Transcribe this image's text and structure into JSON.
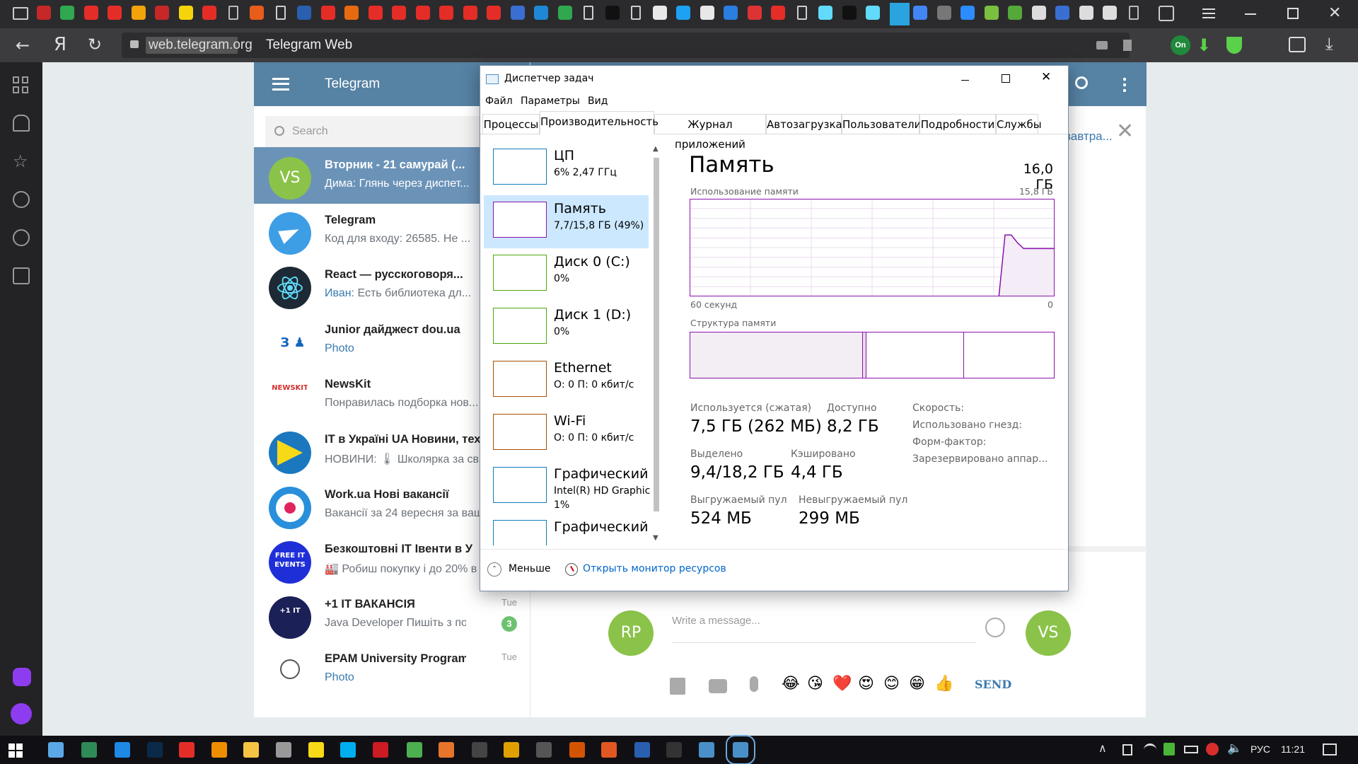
{
  "browser": {
    "url": "web.telegram.org",
    "page_title": "Telegram Web",
    "tab_icons": [
      "window-icon",
      "x-icon",
      "plus-icon",
      "youtube-icon",
      "youtube-icon",
      "bc-icon",
      "x-icon",
      "borussia-icon",
      "youtube-icon",
      "back-arrow-icon",
      "fc-icon",
      "doc-icon",
      "globe-icon",
      "youtube-icon",
      "paw-icon",
      "youtube-icon",
      "youtube-icon",
      "youtube-icon",
      "youtube-icon",
      "youtube-icon",
      "mail-icon",
      "image-icon",
      "w-icon",
      "chat-icon",
      "doc-icon",
      "m-icon",
      "doc-icon",
      "t-icon",
      "circle-icon",
      "t-icon",
      "play-icon",
      "shield-icon",
      "yandex-icon",
      "doc-icon",
      "react-icon",
      "m-icon",
      "react-icon",
      "telegram-icon",
      "docs-icon",
      "tab-icon",
      "zoom-icon",
      "sp-icon",
      "hex-icon",
      "github-icon",
      "image-icon",
      "github-icon",
      "github-icon",
      "new-tab-icon"
    ]
  },
  "telegram": {
    "header_title": "Telegram",
    "search_placeholder": "Search",
    "chats": [
      {
        "avatar_text": "VS",
        "title": "Вторник - 21 самурай (...",
        "message": "Дима: Глянь через диспет...",
        "selected": true,
        "avatar_color": "#8bc34a"
      },
      {
        "avatar_text": "",
        "title": "Telegram",
        "message": "Код для входу: 26585. Не ...",
        "avatar_color": "#3d9ee5"
      },
      {
        "avatar_text": "",
        "title": "React — русскоговоря...",
        "sender": "Иван:",
        "message": "Есть библиотека дл...",
        "avatar_color": "#1d2a35"
      },
      {
        "avatar_text": "",
        "title": "Junior дайджест dou.ua",
        "message": "Photo",
        "avatar_color": "#ffffff"
      },
      {
        "avatar_text": "NEWSKIT",
        "title": "NewsKit",
        "message": "Понравилась подборка нов...",
        "avatar_color": "#ffffff"
      },
      {
        "avatar_text": "",
        "title": "IT в Україні UA Новини, тех",
        "message": "НОВИНИ:  🌡 Школярка за сві",
        "avatar_color": "#1b78bf"
      },
      {
        "avatar_text": "",
        "title": "Work.ua Нові вакансії",
        "message": "Вакансії за 24 вересня за ваш",
        "avatar_color": "#2a8fdb"
      },
      {
        "avatar_text": "FREE IT EVENTS",
        "title": "Безкоштовні IT Івенти в У",
        "message": "🏭 Робиш покупку і до 20% в",
        "avatar_color": "#1f2fd8"
      },
      {
        "avatar_text": "+1 IT",
        "title": "+1 IT ВАКАНСІЯ",
        "message": "Java Developer Пишіть з помітк...",
        "time": "Tue",
        "badge": "3",
        "avatar_color": "#1b2057"
      },
      {
        "avatar_text": "",
        "title": "EPAM University Programs UA",
        "message": "Photo",
        "time": "Tue",
        "avatar_color": "#ffffff"
      }
    ],
    "right_header_partial": "завтра...",
    "composer": {
      "placeholder": "Write a message...",
      "send_label": "SEND",
      "my_avatar": "RP",
      "peer_avatar": "VS",
      "emojis": [
        "😂",
        "😘",
        "❤️",
        "😍",
        "😊",
        "😁",
        "👍"
      ]
    }
  },
  "task_manager": {
    "title": "Диспетчер задач",
    "menu": [
      "Файл",
      "Параметры",
      "Вид"
    ],
    "tabs": [
      "Процессы",
      "Производительность",
      "Журнал приложений",
      "Автозагрузка",
      "Пользователи",
      "Подробности",
      "Службы"
    ],
    "active_tab": "Производительность",
    "resources": [
      {
        "name": "ЦП",
        "sub": "6% 2,47 ГГц",
        "color": "#117dbb"
      },
      {
        "name": "Память",
        "sub": "7,7/15,8 ГБ (49%)",
        "color": "#8b12ae",
        "selected": true
      },
      {
        "name": "Диск 0 (C:)",
        "sub": "0%",
        "color": "#4da60c"
      },
      {
        "name": "Диск 1 (D:)",
        "sub": "0%",
        "color": "#4da60c"
      },
      {
        "name": "Ethernet",
        "sub": "О: 0 П: 0 кбит/с",
        "color": "#a74f01"
      },
      {
        "name": "Wi-Fi",
        "sub": "О: 0 П: 0 кбит/с",
        "color": "#a74f01"
      },
      {
        "name": "Графический п",
        "sub": "Intel(R) HD Graphics",
        "sub2": "1%",
        "color": "#117dbb"
      },
      {
        "name": "Графический п",
        "sub": "",
        "color": "#117dbb"
      }
    ],
    "memory": {
      "heading": "Память",
      "total": "16,0 ГБ",
      "usage_label": "Использование памяти",
      "usage_max": "15,8 ГБ",
      "time_left": "60 секунд",
      "time_right": "0",
      "structure_label": "Структура памяти",
      "in_use_label": "Используется (сжатая)",
      "in_use": "7,5 ГБ (262 МБ)",
      "available_label": "Доступно",
      "available": "8,2 ГБ",
      "committed_label": "Выделено",
      "committed": "9,4/18,2 ГБ",
      "cached_label": "Кэшировано",
      "cached": "4,4 ГБ",
      "paged_label": "Выгружаемый пул",
      "paged": "524 МБ",
      "nonpaged_label": "Невыгружаемый пул",
      "nonpaged": "299 МБ",
      "speed_label": "Скорость:",
      "slots_label": "Использовано гнезд:",
      "form_label": "Форм-фактор:",
      "reserved_label": "Зарезервировано аппар...",
      "usage_series": [
        0,
        0,
        0,
        0,
        0,
        0,
        0,
        0,
        0,
        0,
        0,
        0,
        0,
        0,
        0,
        0,
        0,
        0,
        0,
        0,
        0,
        0,
        0,
        0,
        0,
        0,
        0,
        0,
        0,
        0,
        0,
        0,
        0,
        0,
        0,
        0,
        0,
        0,
        0,
        0,
        0,
        0,
        0,
        0,
        0,
        0,
        0,
        0,
        0,
        0,
        0,
        0.63,
        0.63,
        0.55,
        0.49,
        0.49,
        0.49,
        0.49,
        0.49,
        0.49
      ]
    },
    "footer": {
      "less_label": "Меньше",
      "monitor_label": "Открыть монитор ресурсов"
    }
  },
  "taskbar": {
    "lang": "РУС",
    "time": "11:21"
  }
}
